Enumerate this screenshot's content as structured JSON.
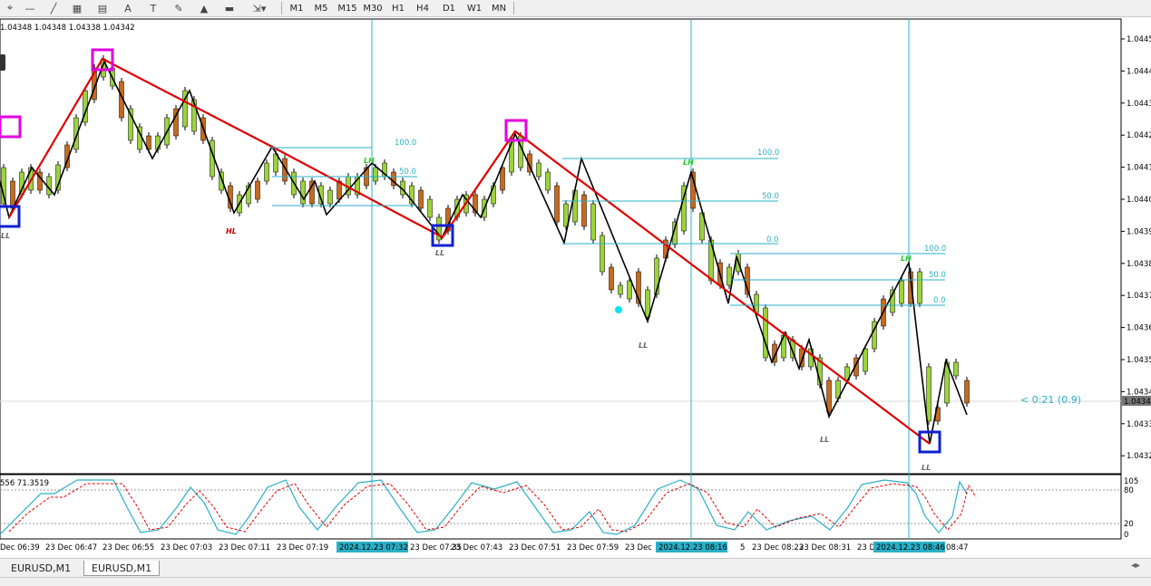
{
  "toolbar": {
    "tools": [
      "cursor-icon",
      "horizontal-line-icon",
      "trendline-icon",
      "fibonacci-icon",
      "fib-fan-icon",
      "text-icon",
      "text-label-icon",
      "pencil-icon",
      "triangle-icon",
      "rectangle-icon",
      "arrows-icon"
    ],
    "text_tool_label": "A",
    "timeframes": [
      "M1",
      "M5",
      "M15",
      "M30",
      "H1",
      "H4",
      "D1",
      "W1",
      "MN"
    ]
  },
  "ohlc_text": "1.04348 1.04348 1.04338 1.04342",
  "stoch_text": "556 71.3519",
  "price_axis": [
    "1.0445",
    "1.0444",
    "1.0443",
    "1.0442",
    "1.0441",
    "1.0440",
    "1.0439",
    "1.0438",
    "1.0437",
    "1.0436",
    "1.0435",
    "1.0434",
    "1.0433",
    "1.0432"
  ],
  "current_price": "1.0434",
  "countdown": "< 0:21 (0.9)",
  "stoch_axis": [
    "105",
    "80",
    "20",
    "0"
  ],
  "time_axis": [
    "Dec 06:39",
    "23 Dec 06:47",
    "23 Dec 06:55",
    "23 Dec 07:03",
    "23 Dec 07:11",
    "23 Dec 07:19",
    "23 Dec 07:35",
    "23 Dec 07:43",
    "23 Dec 07:51",
    "23 Dec 07:59",
    "23 Dec",
    "5",
    "23 Dec 08:23",
    "23 Dec 08:31",
    "23 D",
    "08:47"
  ],
  "time_highlights": [
    "2024.12.23 07:32",
    "2024.12.23 08:16",
    "2024.12.23 08:46"
  ],
  "swing_labels": {
    "ll": "LL",
    "hl": "HL",
    "lh": "LH"
  },
  "fib_levels": [
    "100.0",
    "50.0",
    "0.0"
  ],
  "tabs": [
    "EURUSD,M1",
    "EURUSD,M1"
  ],
  "colors": {
    "bull": "#9bd43a",
    "bear": "#c8691c",
    "zigzag_red": "#e00000",
    "fib": "#2ab0c8",
    "stoch_main": "#2ab0c8",
    "stoch_signal": "#e00000",
    "high_box": "#e000e0",
    "low_box": "#1020d0"
  }
}
